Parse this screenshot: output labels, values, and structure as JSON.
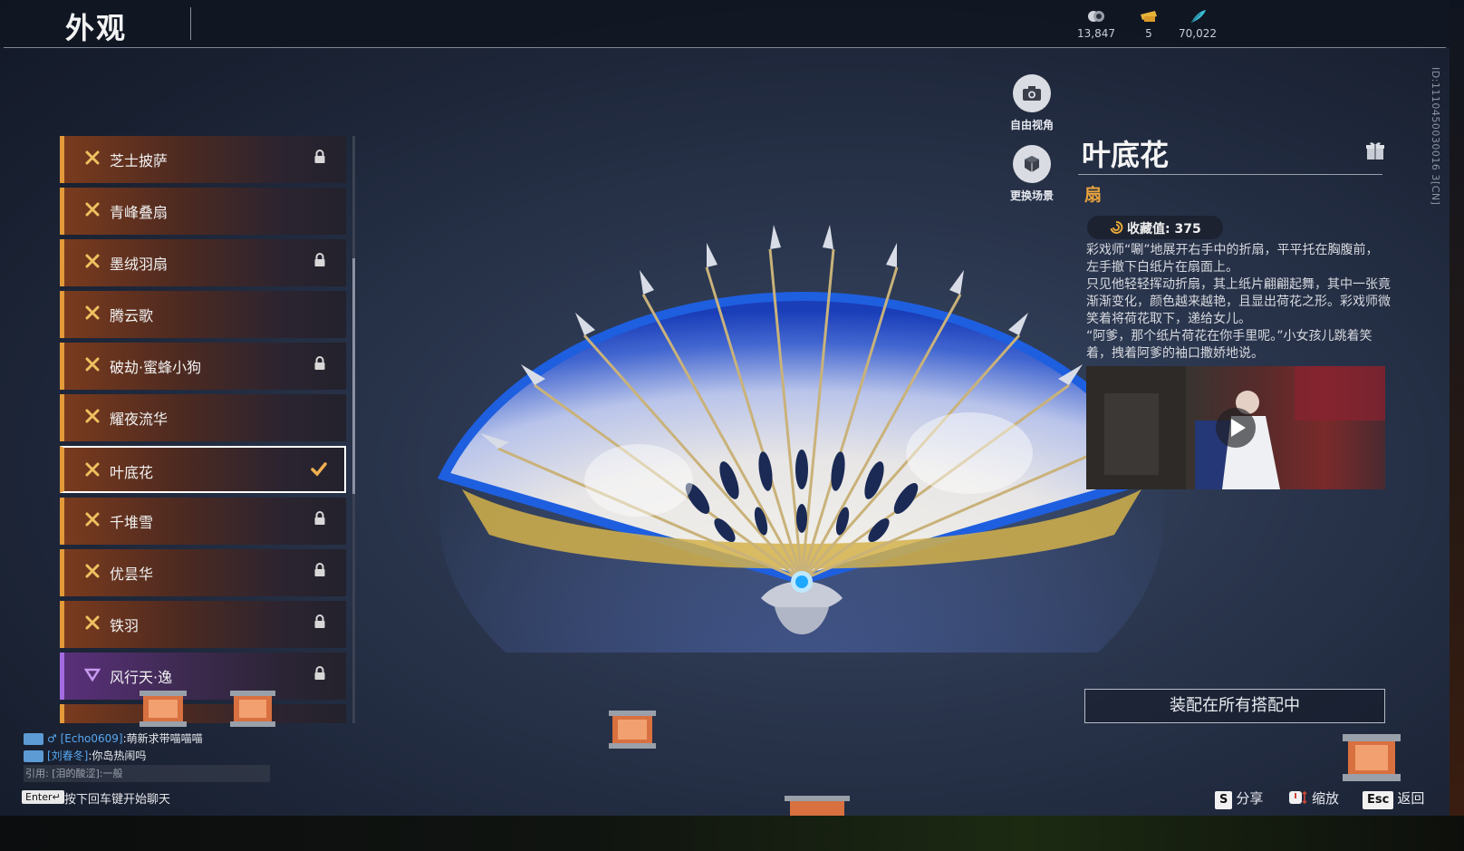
{
  "header": {
    "title": "外观"
  },
  "currencies": [
    {
      "icon": "coin-stack-icon",
      "value": "13,847"
    },
    {
      "icon": "ticket-icon",
      "value": "5"
    },
    {
      "icon": "feather-icon",
      "value": "70,022"
    }
  ],
  "uid": "ID:1110450030016 3[CN]",
  "camera": {
    "free_view": "自由视角",
    "change_scene": "更换场景"
  },
  "list": {
    "items": [
      {
        "label": "芝士披萨",
        "locked": true
      },
      {
        "label": "青峰叠扇",
        "locked": false
      },
      {
        "label": "墨绒羽扇",
        "locked": true
      },
      {
        "label": "腾云歌",
        "locked": false
      },
      {
        "label": "破劫·蜜蜂小狗",
        "locked": true
      },
      {
        "label": "耀夜流华",
        "locked": false
      },
      {
        "label": "叶底花",
        "locked": false,
        "selected": true
      },
      {
        "label": "千堆雪",
        "locked": true
      },
      {
        "label": "优昙华",
        "locked": true
      },
      {
        "label": "铁羽",
        "locked": true
      },
      {
        "label": "风行天·逸",
        "locked": true,
        "rarity": "purple"
      }
    ]
  },
  "detail": {
    "name": "叶底花",
    "type": "扇",
    "collection_label": "收藏值: 375",
    "description": [
      "彩戏师“唰”地展开右手中的折扇，平平托在胸腹前，左手撤下白纸片在扇面上。",
      "只见他轻轻挥动折扇，其上纸片翩翩起舞，其中一张竟渐渐变化，颜色越来越艳，且显出荷花之形。彩戏师微笑着将荷花取下，递给女儿。",
      "“阿爹，那个纸片荷花在你手里呢。”小女孩儿跳着笑着，拽着阿爹的袖口撒娇地说。"
    ],
    "equip_button": "装配在所有搭配中"
  },
  "chat": {
    "lines": [
      {
        "user": "[Echo0609]",
        "message": ":萌新求带喵喵喵"
      },
      {
        "user": "[刘春冬]",
        "message": ":你岛热闹吗"
      }
    ],
    "quote": "引用: [泪的酸涩]:一般",
    "enter_key": "Enter↵",
    "enter_hint": "按下回车键开始聊天"
  },
  "hints": {
    "share_key": "S",
    "share": "分享",
    "zoom": "缩放",
    "back_key": "Esc",
    "back": "返回"
  },
  "colors": {
    "accent_orange": "#e39a3a",
    "type_gold": "#e7a33c",
    "rare_purple": "#a46be0"
  }
}
